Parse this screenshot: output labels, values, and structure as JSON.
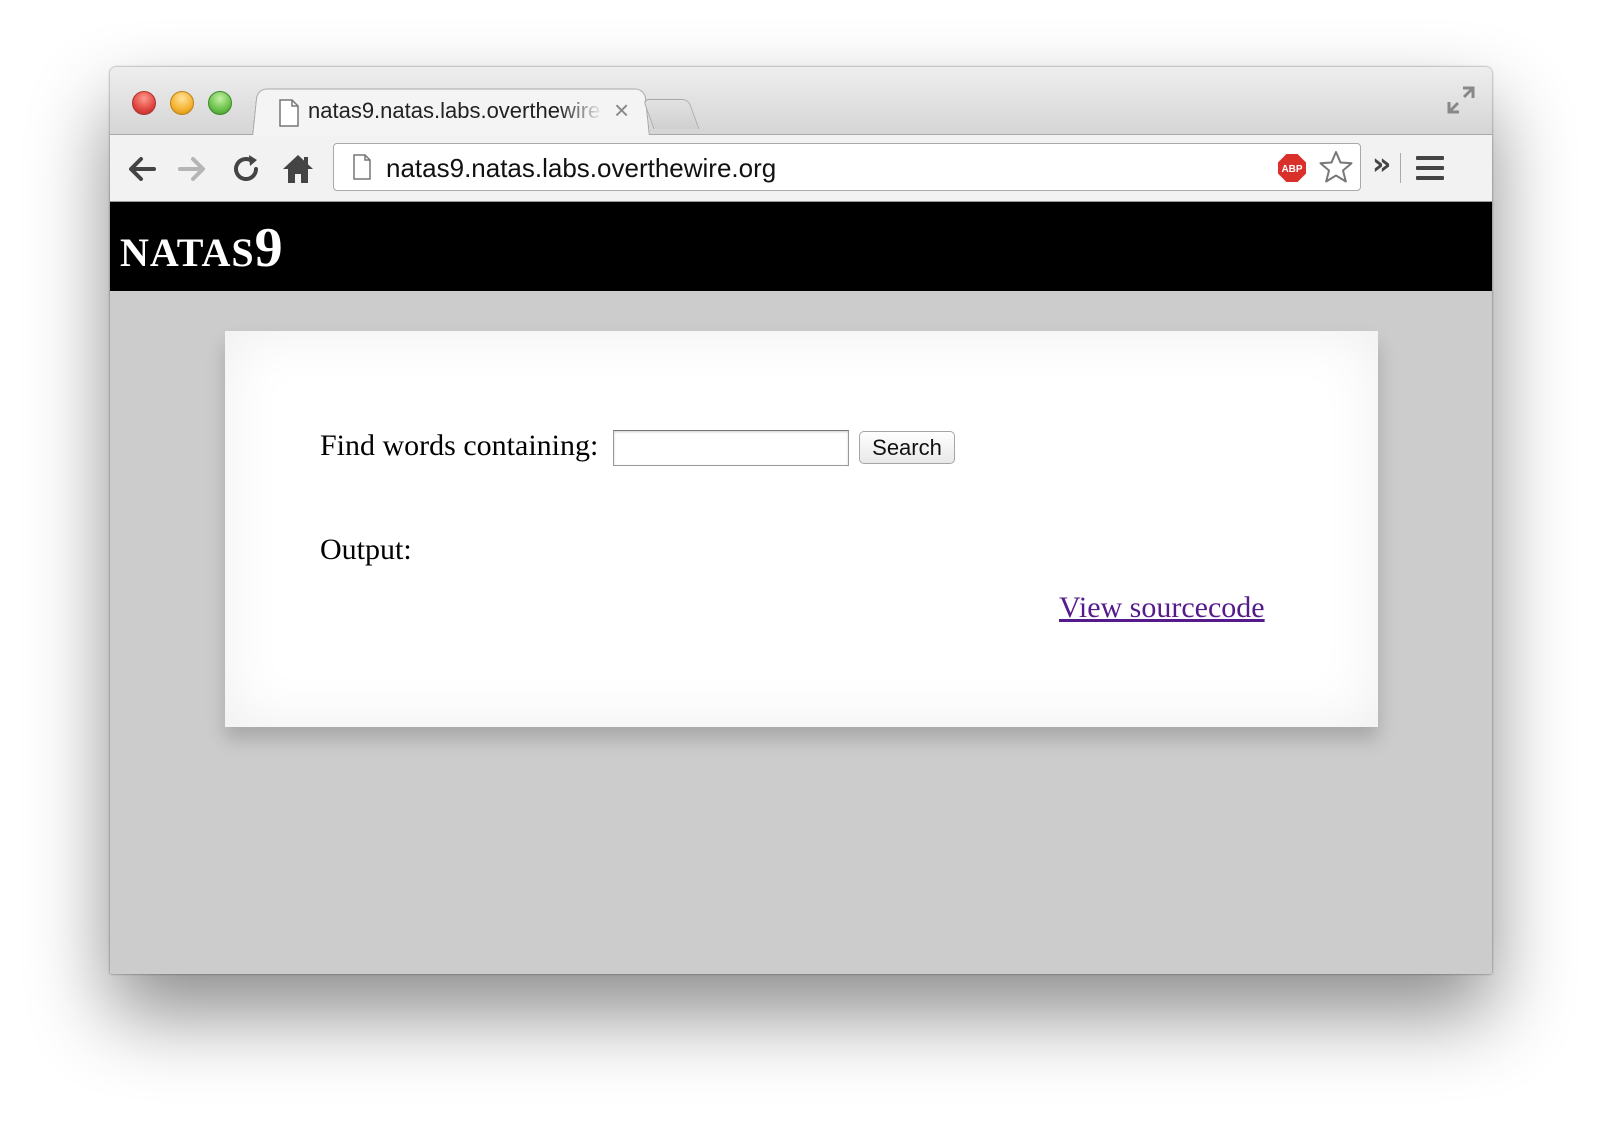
{
  "browser": {
    "tab": {
      "title": "natas9.natas.labs.overthewire.org",
      "close_glyph": "×"
    },
    "toolbar": {
      "url": "natas9.natas.labs.overthewire.org",
      "extensions_chevron": "»"
    },
    "icons": {
      "back": "back-arrow-icon",
      "forward": "forward-arrow-icon",
      "reload": "reload-icon",
      "home": "home-icon",
      "page": "page-icon",
      "adblock": "adblock-plus-icon",
      "bookmark": "star-icon",
      "menu": "hamburger-menu-icon",
      "fullscreen": "fullscreen-icon"
    },
    "colors": {
      "close": "#e0443e",
      "minimize": "#f5b12f",
      "maximize": "#69c04a"
    }
  },
  "page": {
    "header": {
      "title_word": "NATAS",
      "title_number": "9"
    },
    "form": {
      "label": "Find words containing:",
      "input_value": "",
      "submit_label": "Search"
    },
    "output_label": "Output:",
    "source_link": "View sourcecode",
    "colors": {
      "header_bg": "#000000",
      "page_bg": "#cccccc",
      "link": "#551a8b"
    }
  }
}
